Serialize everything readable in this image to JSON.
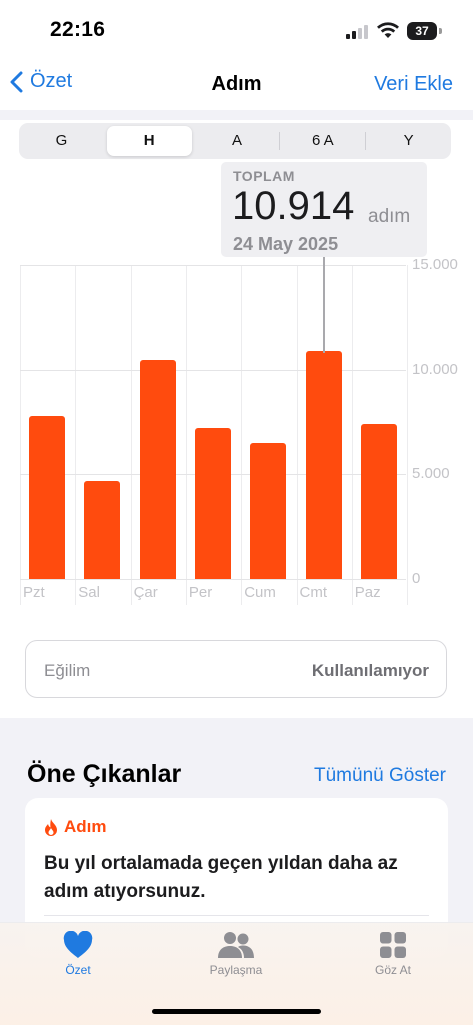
{
  "status_bar": {
    "time": "22:16",
    "battery": "37"
  },
  "nav": {
    "back_label": "Özet",
    "title": "Adım",
    "action_label": "Veri Ekle"
  },
  "segments": [
    "G",
    "H",
    "A",
    "6 A",
    "Y"
  ],
  "selected_segment": "H",
  "tooltip": {
    "label": "TOPLAM",
    "value": "10.914",
    "unit": "adım",
    "date": "24 May 2025"
  },
  "chart_data": {
    "type": "bar",
    "categories": [
      "Pzt",
      "Sal",
      "Çar",
      "Per",
      "Cum",
      "Cmt",
      "Paz"
    ],
    "values": [
      7800,
      4700,
      10450,
      7200,
      6500,
      10914,
      7400
    ],
    "ylim": [
      0,
      15000
    ],
    "y_ticks": [
      "15.000",
      "10.000",
      "5.000",
      "0"
    ],
    "y_tick_values": [
      15000,
      10000,
      5000,
      0
    ],
    "bar_color": "#ff4b0e",
    "grid": true
  },
  "trend": {
    "label": "Eğilim",
    "value": "Kullanılamıyor"
  },
  "highlights": {
    "title": "Öne Çıkanlar",
    "show_all": "Tümünü Göster",
    "card": {
      "category": "Adım",
      "text": "Bu yıl ortalamada geçen yıldan daha az adım atıyorsunuz."
    }
  },
  "tabs": [
    {
      "label": "Özet",
      "icon": "heart-icon",
      "active": true
    },
    {
      "label": "Paylaşma",
      "icon": "people-icon",
      "active": false
    },
    {
      "label": "Göz At",
      "icon": "grid-icon",
      "active": false
    }
  ],
  "colors": {
    "accent": "#1f7ae0",
    "steps": "#ff4b0e",
    "inactive_tab": "#8e8e93"
  }
}
